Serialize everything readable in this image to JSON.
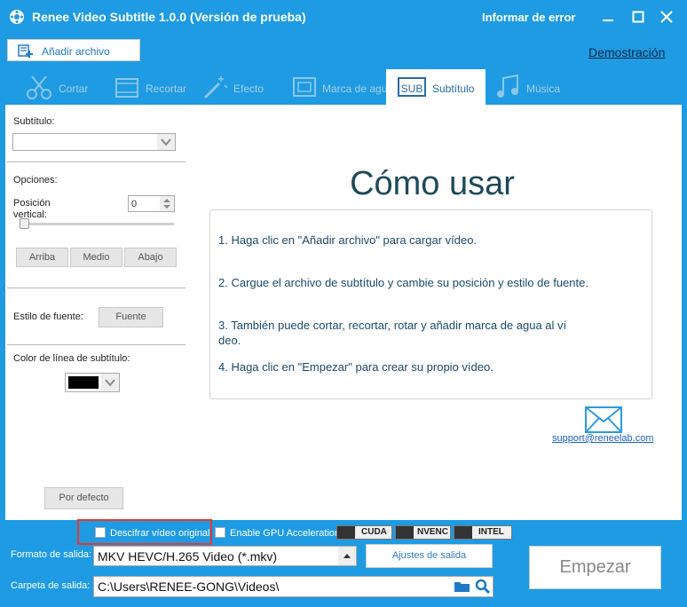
{
  "app": {
    "title": "Renee Video Subtitle 1.0.0 (Versión de prueba)",
    "report_error": "Informar de error"
  },
  "toolbar": {
    "add_file": "Añadir archivo",
    "demo": "Demostración"
  },
  "tabs": [
    {
      "label": "Cortar",
      "icon": "cut-icon"
    },
    {
      "label": "Recortar",
      "icon": "crop-icon"
    },
    {
      "label": "Efecto",
      "icon": "effect-wand-icon"
    },
    {
      "label": "Marca de agua",
      "icon": "watermark-icon"
    },
    {
      "label": "Subtítulo",
      "icon": "subtitle-icon"
    },
    {
      "label": "Música",
      "icon": "music-icon"
    }
  ],
  "left": {
    "subtitle_label": "Subtítulo:",
    "subtitle_value": "",
    "options_label": "Opciones:",
    "vertical_position_label": "Posición\nvertical:",
    "vertical_position_value": "0",
    "slider_value": 0,
    "buttons": {
      "top": "Arriba",
      "middle": "Medio",
      "bottom": "Abajo"
    },
    "font_style_label": "Estilo de fuente:",
    "font_button": "Fuente",
    "line_color_label": "Color de línea de subtítulo:",
    "line_color": "#000000",
    "default_button": "Por defecto"
  },
  "howto": {
    "title": "Cómo usar",
    "steps": [
      "1. Haga clic en \"Añadir archivo\" para cargar vídeo.",
      "2. Cargue el archivo de subtítulo y cambie su posición y estilo de fuente.",
      "3. También puede cortar, recortar, rotar y añadir marca de agua al ví\ndeo.",
      "4. Haga clic en \"Empezar\" para crear su propio vídeo."
    ],
    "support_email": "support@reneelab.com"
  },
  "bottom": {
    "decrypt_label": "Descifrar vídeo original",
    "gpu_label": "Enable GPU Acceleration",
    "gpu_badges": [
      "CUDA",
      "NVENC",
      "INTEL"
    ],
    "output_format_label": "Formato de salida:",
    "output_format_value": "MKV HEVC/H.265 Video (*.mkv)",
    "output_settings": "Ajustes de salida",
    "output_folder_label": "Carpeta de salida:",
    "output_folder_value": "C:\\Users\\RENEE-GONG\\Videos\\",
    "start_button": "Empezar"
  },
  "colors": {
    "accent": "#1e9be2",
    "highlight_box": "#e8372d"
  }
}
